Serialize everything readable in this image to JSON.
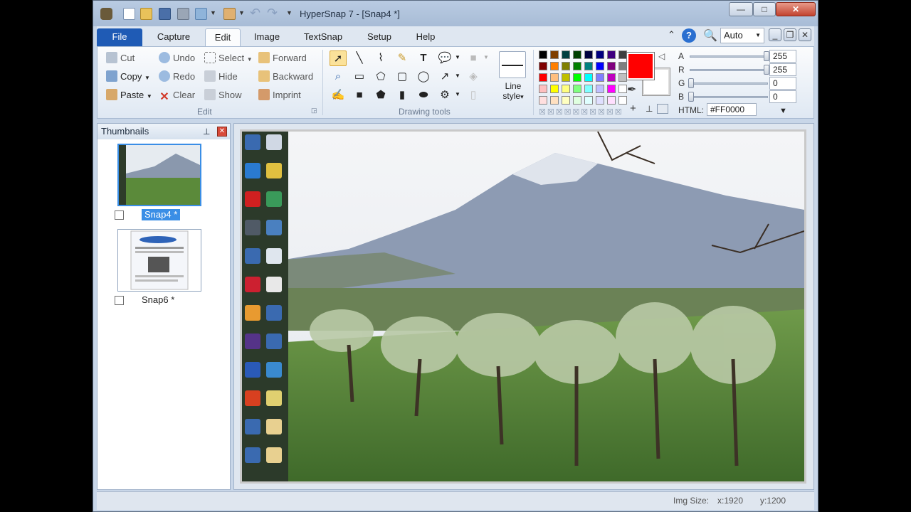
{
  "window": {
    "title": "HyperSnap 7 - [Snap4 *]"
  },
  "tabs": [
    {
      "label": "File"
    },
    {
      "label": "Capture"
    },
    {
      "label": "Edit"
    },
    {
      "label": "Image"
    },
    {
      "label": "TextSnap"
    },
    {
      "label": "Setup"
    },
    {
      "label": "Help"
    }
  ],
  "topright": {
    "zoom_mode": "Auto"
  },
  "edit_group": {
    "label": "Edit",
    "col1": [
      "Cut",
      "Copy",
      "Paste"
    ],
    "col2": [
      "Undo",
      "Redo",
      "Clear"
    ],
    "col3": [
      "Select",
      "Hide",
      "Show"
    ],
    "col4": [
      "Forward",
      "Backward",
      "Imprint"
    ]
  },
  "drawing_group": {
    "label": "Drawing tools",
    "line_style_label": "Line style",
    "line_style_arrow": "▾"
  },
  "color_panel": {
    "current_color": "#FF0000",
    "alpha_label": "A",
    "red_label": "R",
    "green_label": "G",
    "blue_label": "B",
    "alpha": "255",
    "red": "255",
    "green": "0",
    "blue": "0",
    "html_label": "HTML:",
    "html_value": "#FF0000",
    "palette": [
      "#000000",
      "#7f3f00",
      "#003f3f",
      "#003f00",
      "#00003f",
      "#00007f",
      "#3f007f",
      "#3f3f3f",
      "#7f0000",
      "#ff7f00",
      "#7f7f00",
      "#007f00",
      "#007f7f",
      "#0000ff",
      "#7f007f",
      "#7f7f7f",
      "#ff0000",
      "#ffbf7f",
      "#bfbf00",
      "#00ff00",
      "#00ffff",
      "#7f7fff",
      "#bf00bf",
      "#bfbfbf",
      "#ffbfbf",
      "#ffff00",
      "#ffff7f",
      "#7fff7f",
      "#7fffff",
      "#bfbfff",
      "#ff00ff",
      "#ffffff",
      "#ffdfdf",
      "#ffe0c0",
      "#ffffc0",
      "#dfffdf",
      "#dfffff",
      "#dfdfff",
      "#ffdfff",
      "#ffffff"
    ]
  },
  "thumbnails": {
    "header": "Thumbnails",
    "items": [
      {
        "label": "Snap4 *",
        "selected": true
      },
      {
        "label": "Snap6 *",
        "selected": false
      }
    ]
  },
  "status": {
    "img_size_label": "Img Size:",
    "x": "x:1920",
    "y": "y:1200"
  },
  "icons": {
    "app": "camera-icon",
    "new": "new-doc-icon",
    "open": "folder-icon",
    "save": "save-icon",
    "print": "print-icon"
  }
}
